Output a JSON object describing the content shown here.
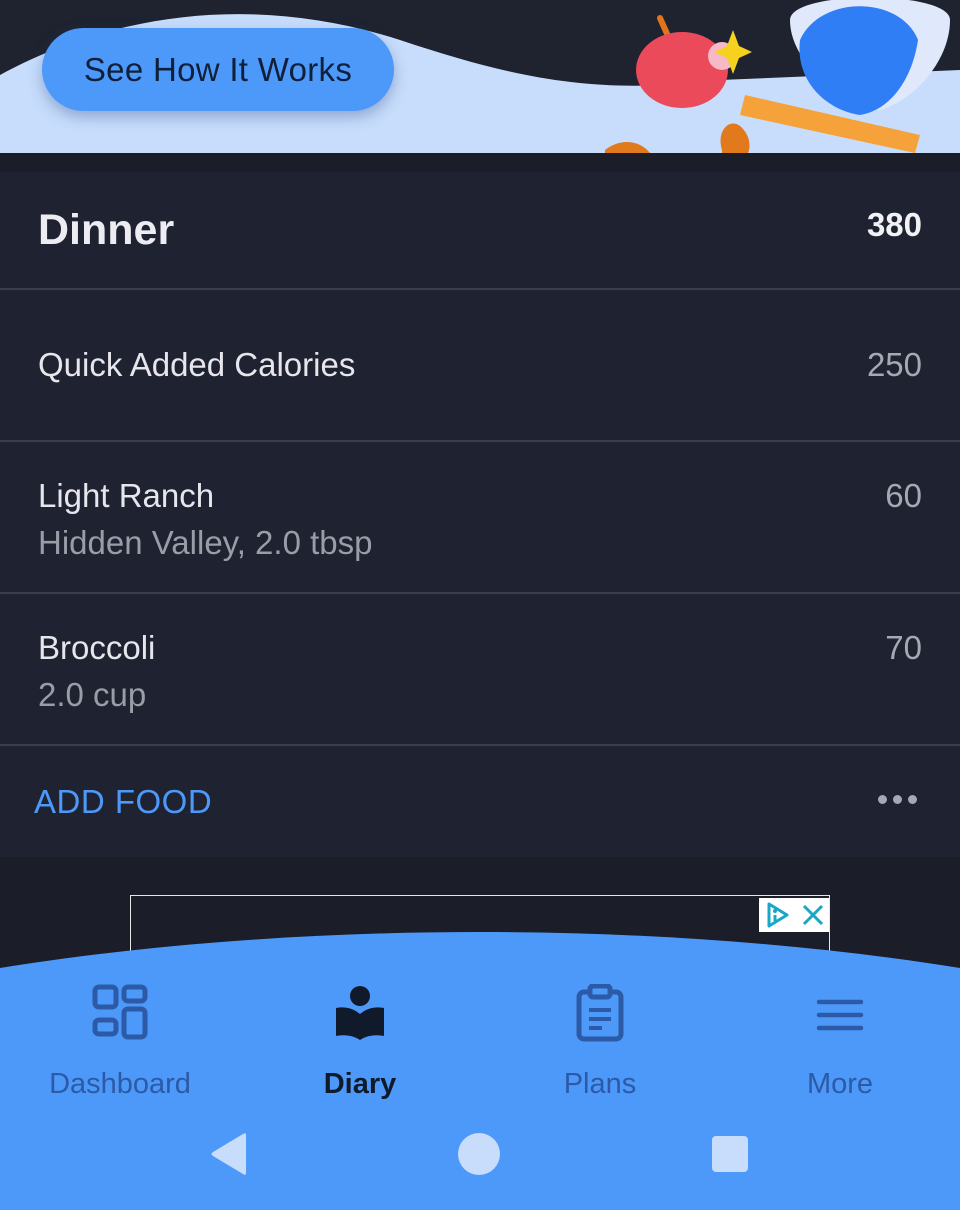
{
  "banner": {
    "button_label": "See How It Works"
  },
  "meal": {
    "title": "Dinner",
    "total": "380",
    "items": [
      {
        "name": "Quick Added Calories",
        "detail": "",
        "calories": "250"
      },
      {
        "name": "Light Ranch",
        "detail": "Hidden Valley, 2.0 tbsp",
        "calories": "60"
      },
      {
        "name": "Broccoli",
        "detail": "2.0 cup",
        "calories": "70"
      }
    ],
    "add_food_label": "ADD FOOD"
  },
  "nav": {
    "items": [
      {
        "label": "Dashboard",
        "icon": "dashboard-icon"
      },
      {
        "label": "Diary",
        "icon": "diary-icon",
        "active": true
      },
      {
        "label": "Plans",
        "icon": "clipboard-icon"
      },
      {
        "label": "More",
        "icon": "menu-icon"
      }
    ]
  },
  "colors": {
    "accent": "#4d99fa",
    "background": "#1b1d28",
    "card": "#1f2230"
  }
}
